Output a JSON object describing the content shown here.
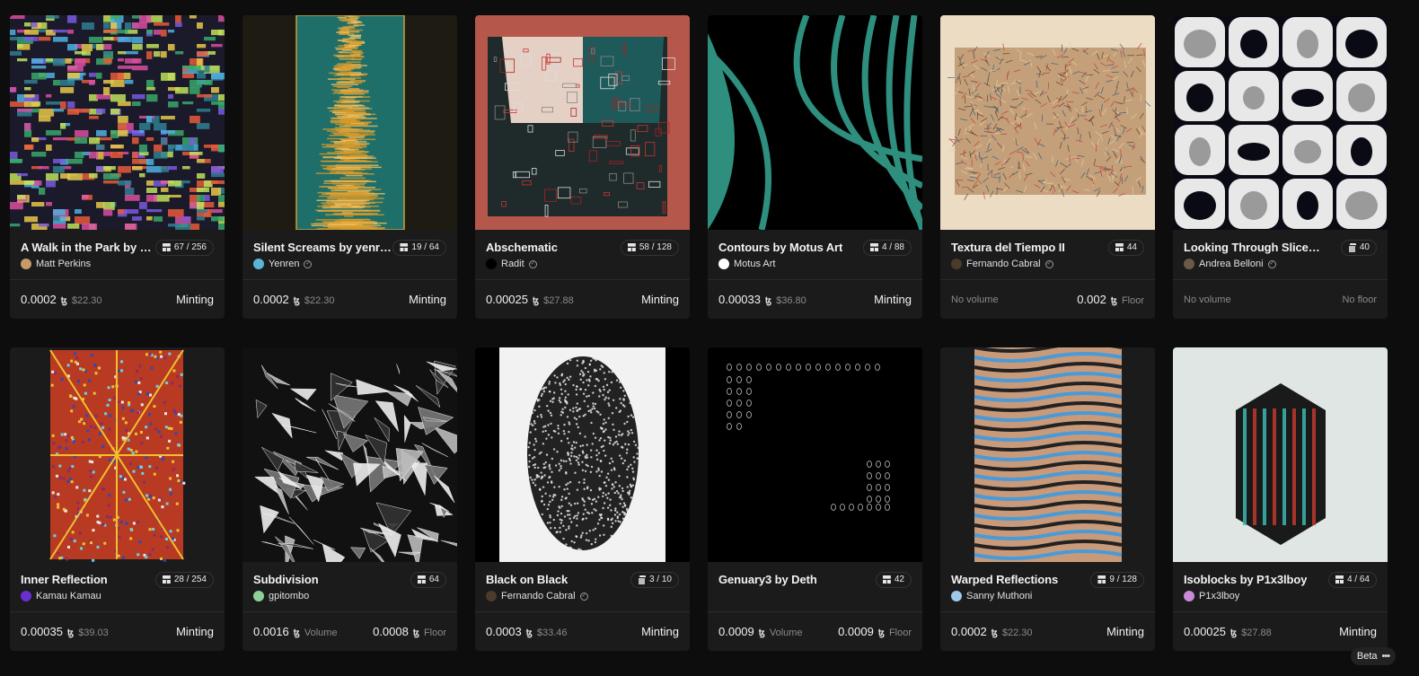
{
  "cards": [
    {
      "title": "A Walk in the Park by Matt …",
      "badge": "67 / 256",
      "badge_icon": "edition-icon",
      "artist": "Matt Perkins",
      "verified": false,
      "avatar_color": "#c89a6a",
      "left_value": "0.0002",
      "left_unit": "ꜩ",
      "left_sub": "$22.30",
      "right_value": "",
      "right_sub": "",
      "right_text": "Minting"
    },
    {
      "title": "Silent Screams by yenren",
      "badge": "19 / 64",
      "badge_icon": "edition-icon",
      "artist": "Yenren",
      "verified": true,
      "avatar_color": "#5ab4d6",
      "left_value": "0.0002",
      "left_unit": "ꜩ",
      "left_sub": "$22.30",
      "right_value": "",
      "right_sub": "",
      "right_text": "Minting"
    },
    {
      "title": "Abschematic",
      "badge": "58 / 128",
      "badge_icon": "edition-icon",
      "artist": "Radit",
      "verified": true,
      "avatar_color": "#000000",
      "left_value": "0.00025",
      "left_unit": "ꜩ",
      "left_sub": "$27.88",
      "right_value": "",
      "right_sub": "",
      "right_text": "Minting"
    },
    {
      "title": "Contours by Motus Art",
      "badge": "4 / 88",
      "badge_icon": "edition-icon",
      "artist": "Motus Art",
      "verified": false,
      "avatar_color": "#ffffff",
      "left_value": "0.00033",
      "left_unit": "ꜩ",
      "left_sub": "$36.80",
      "right_value": "",
      "right_sub": "",
      "right_text": "Minting"
    },
    {
      "title": "Textura del Tiempo II",
      "badge": "44",
      "badge_icon": "edition-icon",
      "artist": "Fernando Cabral",
      "verified": true,
      "avatar_color": "#4a3b2a",
      "left_value": "",
      "left_unit": "",
      "left_sub": "No volume",
      "right_value": "0.002",
      "right_sub": "Floor",
      "right_text": ""
    },
    {
      "title": "Looking Through Sliced Ti…",
      "badge": "40",
      "badge_icon": "copies-icon",
      "artist": "Andrea Belloni",
      "verified": true,
      "avatar_color": "#6b5a48",
      "left_value": "",
      "left_unit": "",
      "left_sub": "No volume",
      "right_value": "",
      "right_sub": "No floor",
      "right_text": ""
    },
    {
      "title": "Inner Reflection",
      "badge": "28 / 254",
      "badge_icon": "edition-icon",
      "artist": "Kamau Kamau",
      "verified": false,
      "avatar_color": "#6a2fd0",
      "left_value": "0.00035",
      "left_unit": "ꜩ",
      "left_sub": "$39.03",
      "right_value": "",
      "right_sub": "",
      "right_text": "Minting"
    },
    {
      "title": "Subdivision",
      "badge": "64",
      "badge_icon": "edition-icon",
      "artist": "gpitombo",
      "verified": false,
      "avatar_color": "#8fcf9a",
      "left_value": "0.0016",
      "left_unit": "ꜩ",
      "left_sub": "Volume",
      "right_value": "0.0008",
      "right_sub": "Floor",
      "right_text": ""
    },
    {
      "title": "Black on Black",
      "badge": "3 / 10",
      "badge_icon": "copies-icon",
      "artist": "Fernando Cabral",
      "verified": true,
      "avatar_color": "#4a3b2a",
      "left_value": "0.0003",
      "left_unit": "ꜩ",
      "left_sub": "$33.46",
      "right_value": "",
      "right_sub": "",
      "right_text": "Minting"
    },
    {
      "title": "Genuary3 by Deth",
      "badge": "42",
      "badge_icon": "edition-icon",
      "artist": "",
      "verified": false,
      "avatar_color": "",
      "left_value": "0.0009",
      "left_unit": "ꜩ",
      "left_sub": "Volume",
      "right_value": "0.0009",
      "right_sub": "Floor",
      "right_text": ""
    },
    {
      "title": "Warped Reflections",
      "badge": "9 / 128",
      "badge_icon": "edition-icon",
      "artist": "Sanny Muthoni",
      "verified": false,
      "avatar_color": "#9fc7e8",
      "left_value": "0.0002",
      "left_unit": "ꜩ",
      "left_sub": "$22.30",
      "right_value": "",
      "right_sub": "",
      "right_text": "Minting"
    },
    {
      "title": "Isoblocks by P1x3lboy",
      "badge": "4 / 64",
      "badge_icon": "edition-icon",
      "artist": "P1x3lboy",
      "verified": false,
      "avatar_color": "#c98ad8",
      "left_value": "0.00025",
      "left_unit": "ꜩ",
      "left_sub": "$27.88",
      "right_value": "",
      "right_sub": "",
      "right_text": "Minting"
    }
  ],
  "beta": {
    "label": "Beta",
    "icon": "more-dots-icon"
  }
}
